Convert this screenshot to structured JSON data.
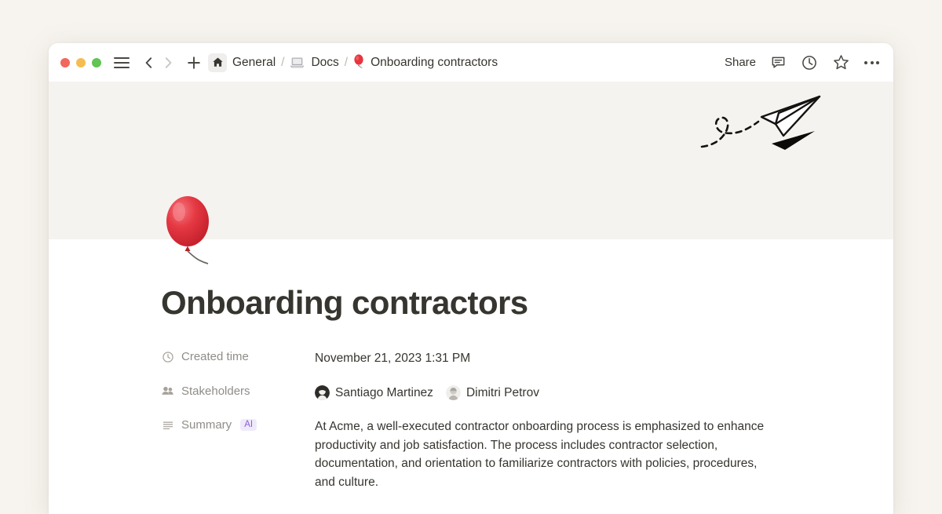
{
  "window": {
    "traffic_lights": [
      "close",
      "minimize",
      "zoom"
    ],
    "sidebar_toggle": "menu-icon",
    "nav_back": "chevron-left-icon",
    "nav_forward": "chevron-right-icon",
    "new_page": "plus-icon"
  },
  "breadcrumb": {
    "home_icon": "home-icon",
    "items": [
      {
        "label": "General",
        "icon": "home-icon"
      },
      {
        "label": "Docs",
        "icon": "laptop-icon"
      },
      {
        "label": "Onboarding contractors",
        "icon": "balloon-emoji"
      }
    ],
    "separator": "/"
  },
  "toolbar": {
    "share_label": "Share",
    "comment_icon": "comment-icon",
    "history_icon": "clock-history-icon",
    "favorite_icon": "star-icon",
    "more_icon": "ellipsis-icon"
  },
  "cover": {
    "illustration": "paper-airplane-illustration",
    "background_color": "#F5F3F0"
  },
  "page": {
    "emoji": "🎈",
    "title": "Onboarding contractors",
    "properties": [
      {
        "icon": "clock-icon",
        "name": "Created time",
        "type": "date",
        "value": "November 21, 2023 1:31 PM"
      },
      {
        "icon": "people-icon",
        "name": "Stakeholders",
        "type": "people",
        "people": [
          {
            "name": "Santiago Martinez",
            "avatar": "avatar-santiago"
          },
          {
            "name": "Dimitri Petrov",
            "avatar": "avatar-dimitri"
          }
        ]
      },
      {
        "icon": "text-lines-icon",
        "name": "Summary",
        "badge": "AI",
        "type": "text",
        "value": "At Acme, a well-executed contractor onboarding process is emphasized to enhance productivity and job satisfaction. The process includes contractor selection, documentation, and orientation to familiarize contractors with policies, procedures, and culture."
      }
    ]
  },
  "colors": {
    "page_background": "#F7F4EF",
    "window_background": "#FFFFFF",
    "cover_background": "#F5F3F0",
    "text_primary": "#37352F",
    "text_secondary": "#908D87",
    "ai_badge_text": "#8A60D6",
    "ai_badge_background": "#EFEAFB",
    "traffic_red": "#F0675C",
    "traffic_yellow": "#F5BD4F",
    "traffic_green": "#61C454"
  }
}
